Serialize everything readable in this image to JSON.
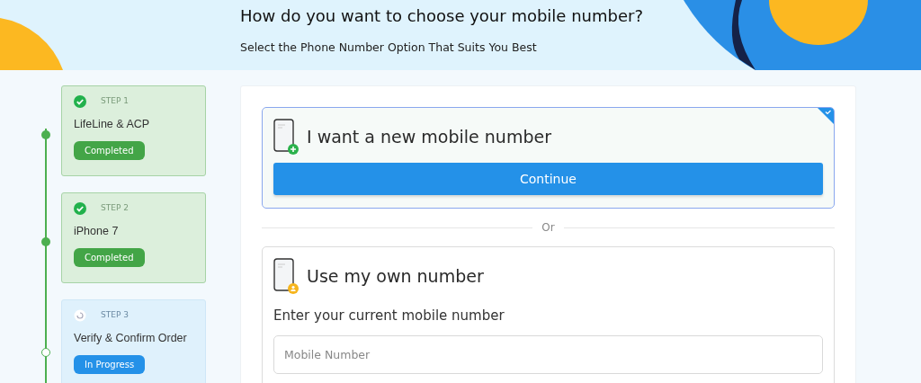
{
  "header": {
    "title": "How do you want to choose your mobile number?",
    "subtitle": "Select the Phone Number Option That Suits You Best"
  },
  "steps": [
    {
      "step": "STEP 1",
      "name": "LifeLine & ACP",
      "status": "Completed",
      "kind": "completed"
    },
    {
      "step": "STEP 2",
      "name": "iPhone 7",
      "status": "Completed",
      "kind": "completed"
    },
    {
      "step": "STEP 3",
      "name": "Verify & Confirm Order",
      "status": "In Progress",
      "kind": "in_progress"
    }
  ],
  "options": [
    {
      "kind": "new",
      "title": "I want a new mobile number",
      "selected": true,
      "button": "Continue"
    },
    {
      "kind": "own",
      "title": "Use my own number",
      "selected": false,
      "field_label": "Enter your current mobile number",
      "placeholder": "Mobile Number"
    }
  ],
  "separator": "Or"
}
